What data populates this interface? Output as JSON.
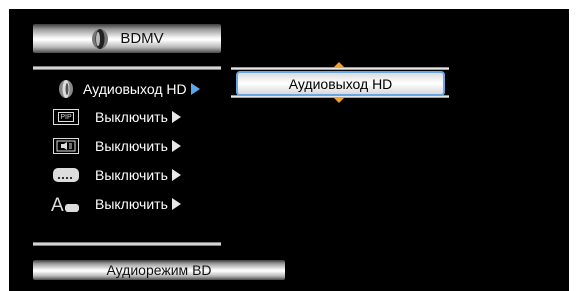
{
  "header": {
    "title": "BDMV",
    "icon": "disc-icon"
  },
  "menu": {
    "items": [
      {
        "label": "Аудиовыход HD",
        "icon": "speaker-icon",
        "selected": true
      },
      {
        "label": "Выключить",
        "icon": "pip-icon",
        "selected": false
      },
      {
        "label": "Выключить",
        "icon": "secondary-audio-icon",
        "selected": false
      },
      {
        "label": "Выключить",
        "icon": "subtitle-icon",
        "selected": false
      },
      {
        "label": "Выключить",
        "icon": "subtitle-style-icon",
        "selected": false
      }
    ]
  },
  "selector": {
    "value": "Аудиовыход HD"
  },
  "footer": {
    "label": "Аудиорежим BD"
  },
  "colors": {
    "selection_border": "#6aa5e6",
    "scroll_arrow": "#f0a030",
    "background": "#000000"
  }
}
